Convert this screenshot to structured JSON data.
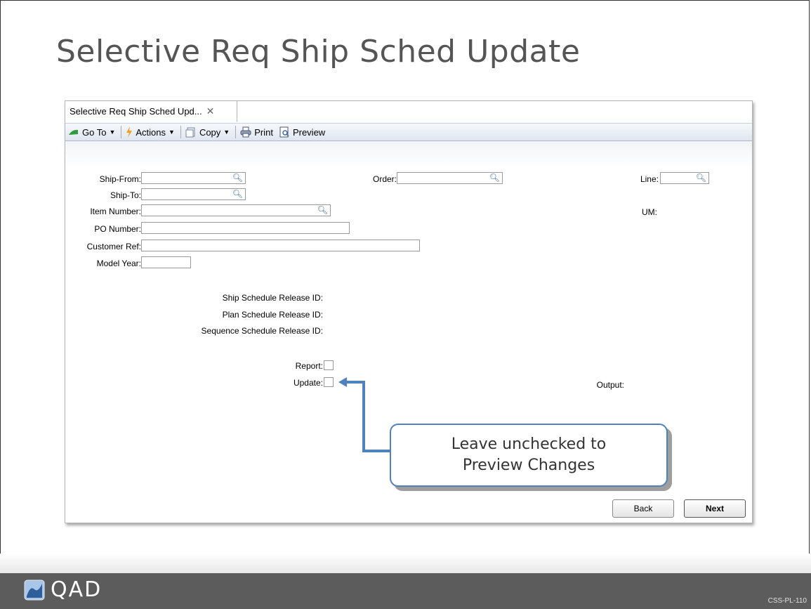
{
  "slide": {
    "title": "Selective Req Ship Sched Update",
    "code": "CSS-PL-110",
    "logo_text": "QAD"
  },
  "window": {
    "tab_label": "Selective Req Ship Sched Upd...",
    "toolbar": {
      "goto": "Go To",
      "actions": "Actions",
      "copy": "Copy",
      "print": "Print",
      "preview": "Preview"
    }
  },
  "form": {
    "ship_from_label": "Ship-From:",
    "ship_to_label": "Ship-To:",
    "item_number_label": "Item Number:",
    "po_number_label": "PO Number:",
    "customer_ref_label": "Customer Ref:",
    "model_year_label": "Model Year:",
    "order_label": "Order:",
    "line_label": "Line:",
    "um_label": "UM:",
    "ship_sched_label": "Ship Schedule Release ID:",
    "plan_sched_label": "Plan Schedule Release ID:",
    "seq_sched_label": "Sequence Schedule Release ID:",
    "report_label": "Report:",
    "update_label": "Update:",
    "output_label": "Output:"
  },
  "buttons": {
    "back": "Back",
    "next": "Next"
  },
  "callout": {
    "line1": "Leave unchecked to",
    "line2": "Preview Changes"
  },
  "colors": {
    "accent": "#4f81bd",
    "footer": "#5c5c5c"
  }
}
